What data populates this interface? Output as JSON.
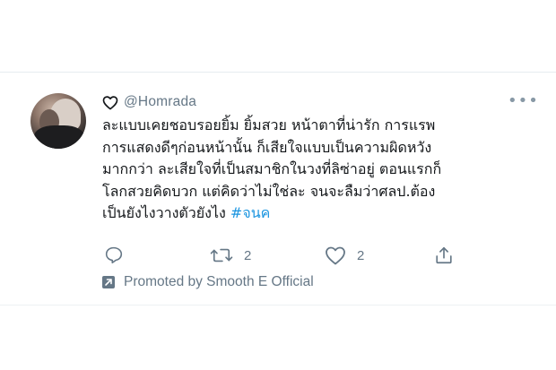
{
  "tweet": {
    "handle": "@Homrada",
    "lines": [
      "ละแบบเคยชอบรอยยิ้ม ยิ้มสวย หน้าตาที่น่ารัก การแรพ",
      "การแสดงดีๆก่อนหน้านั้น ก็เสียใจแบบเป็นความผิดหวัง",
      "มากกว่า ละเสียใจที่เป็นสมาชิกในวงที่ลิซ่าอยู่ ตอนแรกก็",
      "โลกสวยคิดบวก แต่คิดว่าไม่ใช่ละ จนจะลืมว่าศลป.ต้อง",
      "เป็นยังไงวางตัวยังไง "
    ],
    "hashtag": "#จนค",
    "retweet_count": "2",
    "like_count": "2",
    "promoted_text": "Promoted by Smooth E Official"
  },
  "icons": {
    "header": "heart-outline-icon",
    "more": "more-dots-icon",
    "reply": "reply-icon",
    "retweet": "retweet-icon",
    "like": "heart-icon",
    "share": "share-icon",
    "promoted": "promoted-arrow-icon"
  },
  "colors": {
    "text": "#14171a",
    "secondary": "#657786",
    "hashtag": "#1b95e0"
  }
}
